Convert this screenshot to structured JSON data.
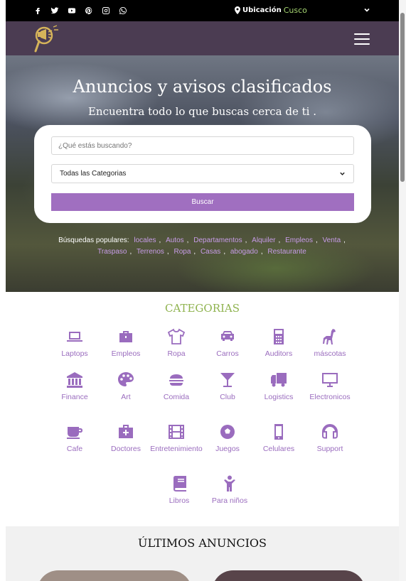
{
  "topbar": {
    "social_icons": [
      "facebook-icon",
      "twitter-icon",
      "youtube-icon",
      "pinterest-icon",
      "instagram-icon",
      "whatsapp-icon"
    ],
    "location_label": "Ubicación",
    "location_city": "Cusco"
  },
  "hero": {
    "title": "Anuncios y avisos clasificados",
    "subtitle": "Encuentra todo lo que buscas cerca de ti .",
    "search_placeholder": "¿Qué estás buscando?",
    "category_selected": "Todas las Categorias",
    "search_button": "Buscar",
    "popular_label": "Búsquedas populares:",
    "popular_terms": [
      "locales",
      "Autos",
      "Departamentos",
      "Alquiler",
      "Empleos",
      "Venta",
      "Traspaso",
      "Terrenos",
      "Ropa",
      "Casas",
      "abogado",
      "Restaurante"
    ]
  },
  "categories": {
    "title": "CATEGORIAS",
    "items": [
      {
        "label": "Laptops",
        "icon": "laptop-icon"
      },
      {
        "label": "Empleos",
        "icon": "briefcase-icon"
      },
      {
        "label": "Ropa",
        "icon": "shirt-icon"
      },
      {
        "label": "Carros",
        "icon": "car-icon"
      },
      {
        "label": "Auditors",
        "icon": "calculator-icon"
      },
      {
        "label": "máscotas",
        "icon": "giraffe-icon"
      },
      {
        "label": "Finance",
        "icon": "bank-icon"
      },
      {
        "label": "Art",
        "icon": "palette-icon"
      },
      {
        "label": "Comida",
        "icon": "burger-icon"
      },
      {
        "label": "Club",
        "icon": "cocktail-icon"
      },
      {
        "label": "Logistics",
        "icon": "truck-icon"
      },
      {
        "label": "Electronicos",
        "icon": "monitor-icon"
      },
      {
        "label": "Cafe",
        "icon": "coffee-icon"
      },
      {
        "label": "Doctores",
        "icon": "medkit-icon"
      },
      {
        "label": "Entretenimiento",
        "icon": "film-icon"
      },
      {
        "label": "Juegos",
        "icon": "soccer-ball-icon"
      },
      {
        "label": "Celulares",
        "icon": "mobile-icon"
      },
      {
        "label": "Support",
        "icon": "headset-icon"
      },
      {
        "label": "Libros",
        "icon": "book-icon"
      },
      {
        "label": "Para niños",
        "icon": "child-icon"
      }
    ]
  },
  "latest": {
    "title": "ÚLTIMOS ANUNCIOS"
  },
  "colors": {
    "accent": "#a06fc0",
    "header": "#4b3c52",
    "category_title": "#8fb34f",
    "city": "#a6d672"
  }
}
